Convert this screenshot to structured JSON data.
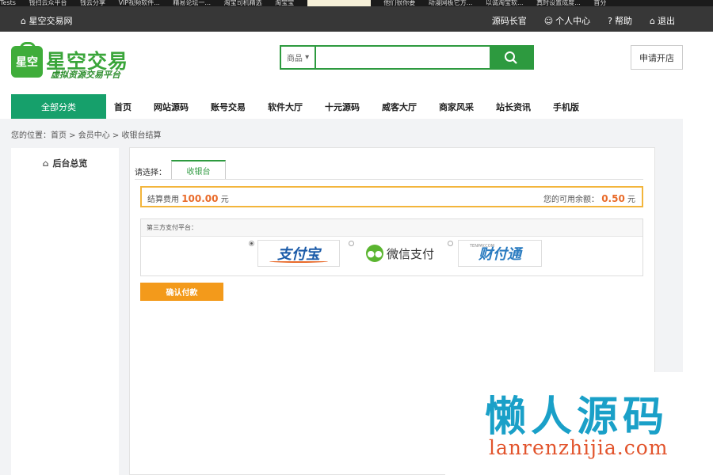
{
  "bookmarks": [
    "Tests",
    "钱扫云众平台",
    "钱云分享",
    "VIP视频软件...",
    "精易论坛一...",
    "淘宝司机精选",
    "淘宝宝",
    "",
    "他们很你要",
    "动漫网板它方...",
    "以诚淘宝软...",
    "真时设置成度...",
    "首分"
  ],
  "topbar": {
    "site_name": "星空交易网",
    "links": [
      {
        "label": "源码长官",
        "icon": ""
      },
      {
        "label": "个人中心",
        "icon": "user-icon"
      },
      {
        "label": "帮助",
        "icon": "help-icon"
      },
      {
        "label": "退出",
        "icon": "logout-icon"
      }
    ]
  },
  "logo": {
    "mark_text": "星空",
    "name": "星空交易",
    "slogan": "虚拟资源交易平台"
  },
  "search": {
    "category": "商品",
    "placeholder": "",
    "value": "",
    "icon": "search-icon"
  },
  "apply_button": "申请开店",
  "nav": {
    "all_categories": "全部分类",
    "items": [
      "首页",
      "网站源码",
      "账号交易",
      "软件大厅",
      "十元源码",
      "威客大厅",
      "商家风采",
      "站长资讯",
      "手机版"
    ]
  },
  "breadcrumb": "您的位置：首页 > 会员中心 > 收银台结算",
  "sidebar": {
    "items": [
      {
        "label": "后台总览",
        "icon": "home-icon"
      }
    ]
  },
  "cashier": {
    "select_label": "请选择：",
    "tab": "收银台",
    "fee_label": "结算费用",
    "fee_value": "100.00",
    "fee_unit": "元",
    "balance_label": "您的可用余额：",
    "balance_value": "0.50",
    "balance_unit": "元",
    "pay_section_title": "第三方支付平台：",
    "payment_options": [
      {
        "label": "支付宝",
        "selected": true
      },
      {
        "label": "微信支付",
        "selected": false
      },
      {
        "label": "财付通",
        "sub": "TENPAY.COM",
        "selected": false
      }
    ],
    "confirm_button": "确认付款"
  },
  "watermark": {
    "title": "懒人源码",
    "url": "lanrenzhijia.com"
  },
  "colors": {
    "brand_green": "#3fad3a",
    "nav_green": "#16a06b",
    "accent_orange": "#f39a1b",
    "amount_orange": "#e96b2a"
  }
}
